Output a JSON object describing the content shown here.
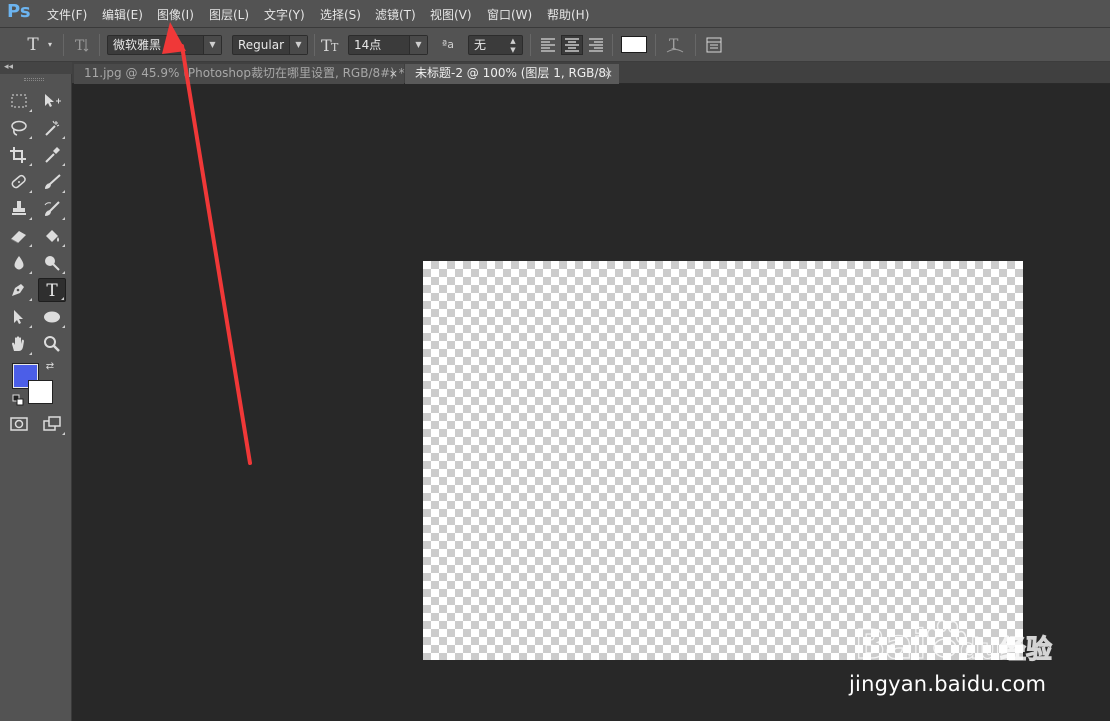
{
  "app": {
    "logo": "Ps"
  },
  "menu": [
    {
      "label": "文件(F)"
    },
    {
      "label": "编辑(E)"
    },
    {
      "label": "图像(I)"
    },
    {
      "label": "图层(L)"
    },
    {
      "label": "文字(Y)"
    },
    {
      "label": "选择(S)"
    },
    {
      "label": "滤镜(T)"
    },
    {
      "label": "视图(V)"
    },
    {
      "label": "窗口(W)"
    },
    {
      "label": "帮助(H)"
    }
  ],
  "options": {
    "font_family": "微软雅黑",
    "font_style": "Regular",
    "font_size": "14点",
    "antialias_label": "ªa",
    "antialias": "无",
    "text_color": "#ffffff"
  },
  "tabs": [
    {
      "label": "11.jpg @ 45.9% (Photoshop裁切在哪里设置, RGB/8#) *",
      "close": "×"
    },
    {
      "label": "未标题-2 @ 100% (图层 1, RGB/8)",
      "close": "×"
    }
  ],
  "toolbar": {
    "collapse": "◂◂",
    "foreground_color": "#4b5ee8",
    "background_color": "#ffffff"
  },
  "colors": {
    "chrome": "#535353",
    "workspace": "#282828",
    "logo": "#6cb4f0",
    "annotation_arrow": "#f03838"
  },
  "watermark": {
    "logo_text": "Bai",
    "logo_text_2": "du",
    "logo_cn": "经验",
    "url": "jingyan.baidu.com"
  }
}
